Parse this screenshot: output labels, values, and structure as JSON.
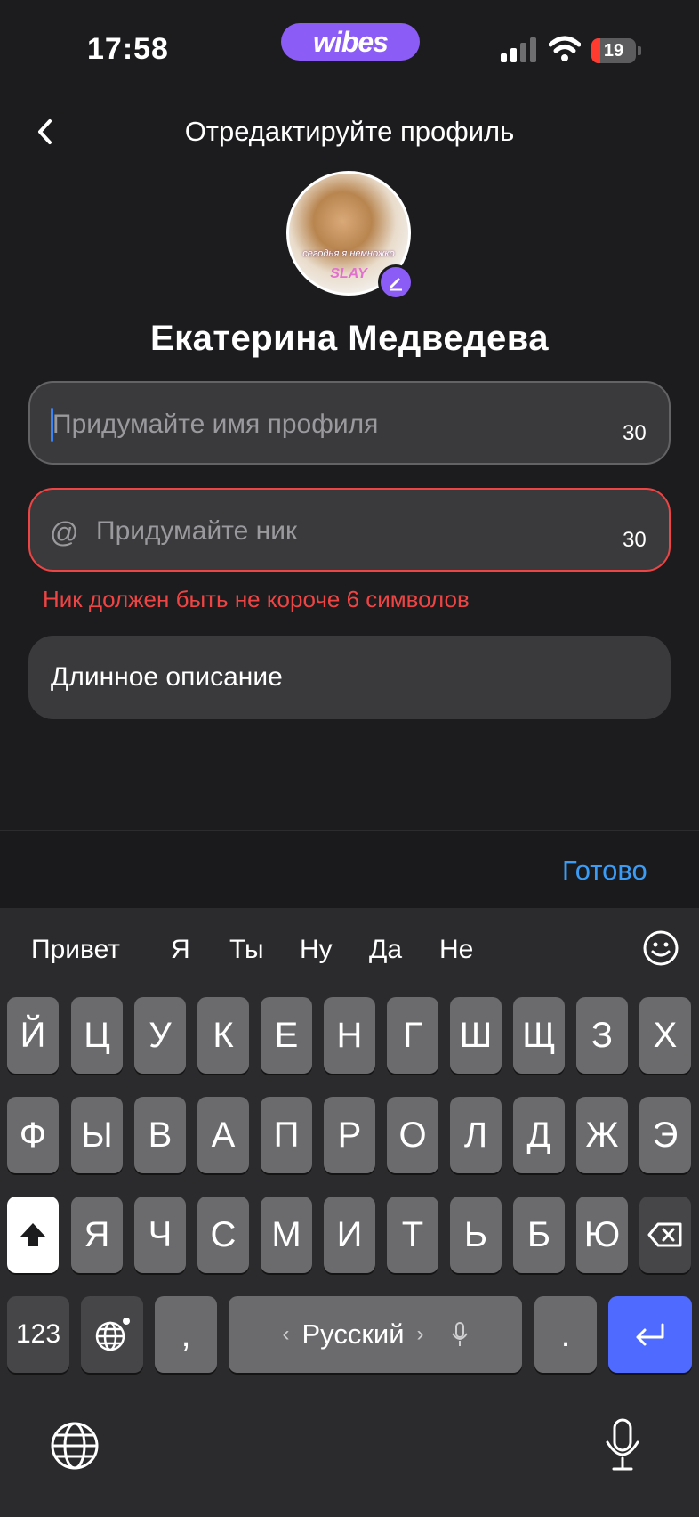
{
  "status_bar": {
    "time": "17:58",
    "app_badge": "wibes",
    "battery": "19"
  },
  "header": {
    "title": "Отредактируйте профиль"
  },
  "avatar": {
    "caption_line1": "сегодня я немножко",
    "caption_line2": "SLAY"
  },
  "profile": {
    "name": "Екатерина Медведева"
  },
  "fields": {
    "name": {
      "placeholder": "Придумайте имя профиля",
      "counter": "30"
    },
    "nick": {
      "prefix": "@",
      "placeholder": "Придумайте ник",
      "counter": "30",
      "error": "Ник должен быть не короче 6 символов"
    },
    "description": {
      "label": "Длинное описание"
    }
  },
  "done_bar": {
    "label": "Готово"
  },
  "keyboard": {
    "suggestions": [
      "Привет",
      "Я",
      "Ты",
      "Ну",
      "Да",
      "Не"
    ],
    "row1": [
      "Й",
      "Ц",
      "У",
      "К",
      "Е",
      "Н",
      "Г",
      "Ш",
      "Щ",
      "З",
      "Х"
    ],
    "row2": [
      "Ф",
      "Ы",
      "В",
      "А",
      "П",
      "Р",
      "О",
      "Л",
      "Д",
      "Ж",
      "Э"
    ],
    "row3": [
      "Я",
      "Ч",
      "С",
      "М",
      "И",
      "Т",
      "Ь",
      "Б",
      "Ю"
    ],
    "numbers_key": "123",
    "comma_key": ",",
    "space_key": "Русский",
    "period_key": ".",
    "accent_color": "#4f6bff"
  }
}
